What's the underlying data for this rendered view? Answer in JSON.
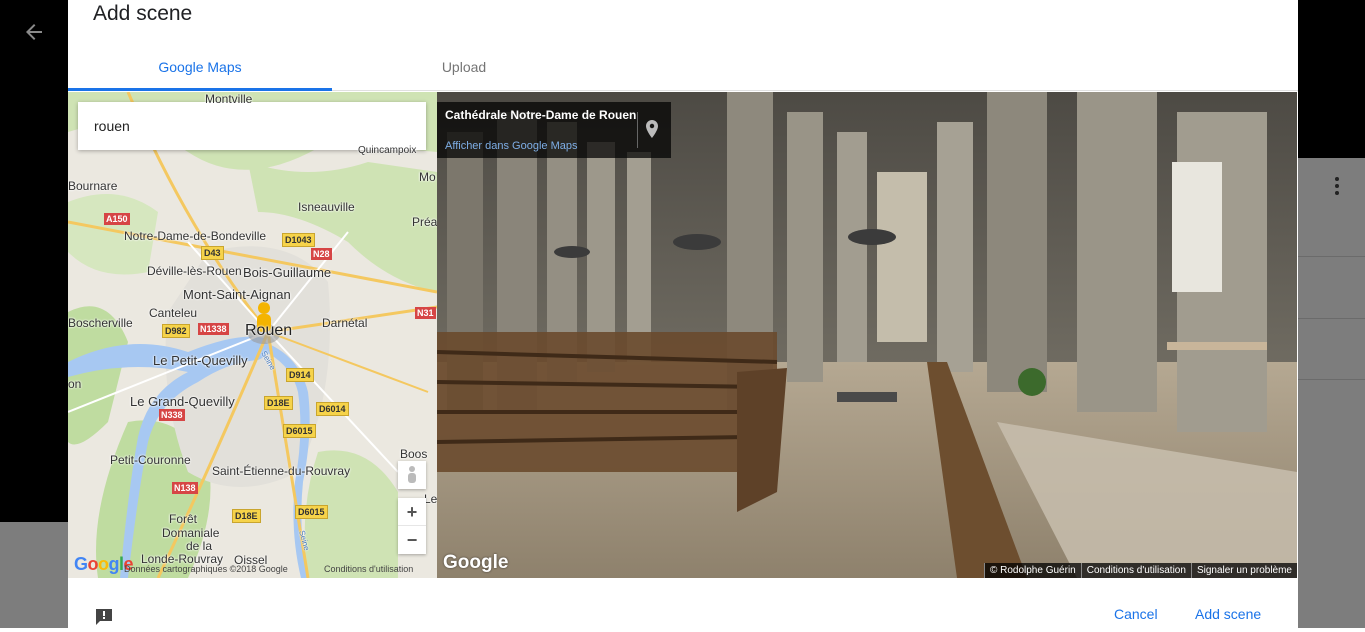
{
  "dialog": {
    "title": "Add scene",
    "tabs": [
      {
        "label": "Google Maps",
        "active": true
      },
      {
        "label": "Upload",
        "active": false
      }
    ],
    "accent_color": "#1a73e8"
  },
  "map": {
    "search_value": "rouen",
    "labels": {
      "montville": "Montville",
      "quincampoix": "Quincampoix",
      "bournare": "Bournare",
      "isneauville": "Isneauville",
      "mo": "Mo",
      "prea": "Préa",
      "notre_dame": "Notre-Dame-de-Bondeville",
      "deville": "Déville-lès-Rouen",
      "bois_guillaume": "Bois-Guillaume",
      "mont_saint_aignan": "Mont-Saint-Aignan",
      "boscherville": "Boscherville",
      "canteleu": "Canteleu",
      "rouen": "Rouen",
      "darnetal": "Darnétal",
      "petit_quevilly": "Le Petit-Quevilly",
      "grand_quevilly": "Le Grand-Quevilly",
      "on": "on",
      "boos": "Boos",
      "petit_couronne": "Petit-Couronne",
      "saint_etienne": "Saint-Étienne-du-Rouvray",
      "le_ne": "Le Ne",
      "foret": "Forêt",
      "domaniale": "Domaniale",
      "de": "de la",
      "londe": "Londe-Rouvray",
      "oissel": "Oissel",
      "seine_a": "Seine",
      "seine_b": "Seine"
    },
    "roads": {
      "a150": "A150",
      "d1043": "D1043",
      "d43": "D43",
      "n28": "N28",
      "n31": "N31",
      "d982": "D982",
      "n1338": "N1338",
      "d914": "D914",
      "d18e_a": "D18E",
      "d6014": "D6014",
      "n338": "N338",
      "d6015_a": "D6015",
      "n138": "N138",
      "d18e_b": "D18E",
      "d6015_b": "D6015"
    },
    "zoom_in": "+",
    "zoom_out": "−",
    "google_logo": "Google",
    "attribution": "Données cartographiques ©2018 Google",
    "terms": "Conditions d'utilisation"
  },
  "streetview": {
    "place_name": "Cathédrale Notre-Dame de Rouen",
    "open_link": "Afficher dans Google Maps",
    "google_logo": "Google",
    "footer": {
      "author": "© Rodolphe Guérin",
      "terms": "Conditions d'utilisation",
      "report": "Signaler un problème"
    }
  },
  "footer": {
    "cancel_label": "Cancel",
    "add_label": "Add scene"
  }
}
